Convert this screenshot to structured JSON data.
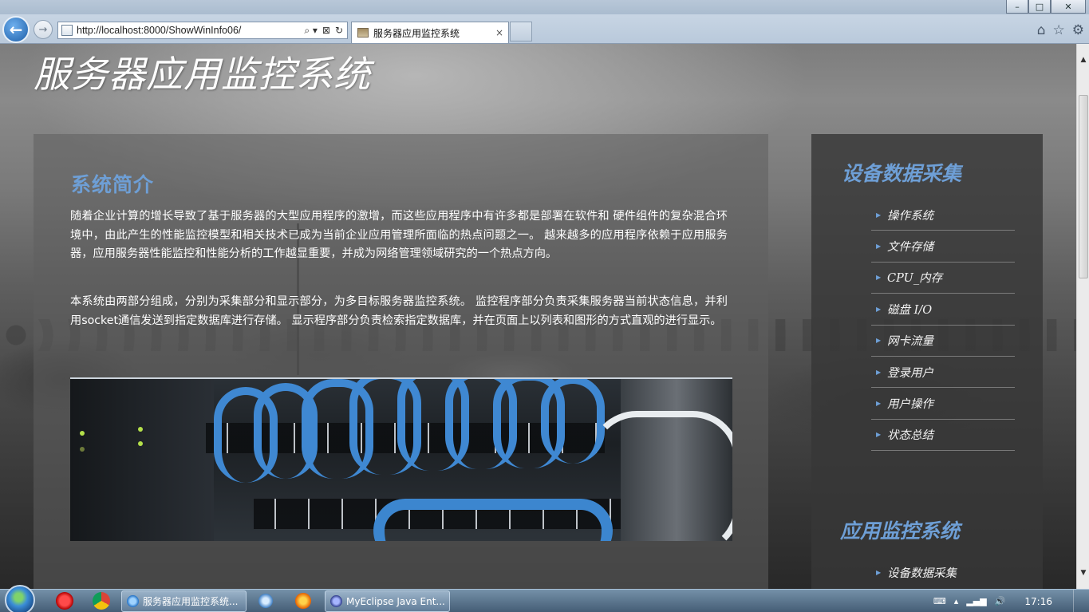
{
  "browser": {
    "url": "http://localhost:8000/ShowWinInfo06/",
    "tab_title": "服务器应用监控系统",
    "tab_close": "×",
    "back_glyph": "←",
    "forward_glyph": "→",
    "addr_tools": [
      "⌕ ▾",
      "⊠",
      "↻"
    ],
    "right_icons": [
      "⌂",
      "☆",
      "⚙"
    ],
    "window_buttons": {
      "minimize": "–",
      "maximize": "□",
      "close": "✕"
    }
  },
  "page": {
    "site_title": "服务器应用监控系统",
    "intro": {
      "heading": "系统简介",
      "paragraphs": [
        "随着企业计算的增长导致了基于服务器的大型应用程序的激增，而这些应用程序中有许多都是部署在软件和 硬件组件的复杂混合环境中，由此产生的性能监控模型和相关技术已成为当前企业应用管理所面临的热点问题之一。 越来越多的应用程序依赖于应用服务器，应用服务器性能监控和性能分析的工作越显重要，并成为网络管理领域研究的一个热点方向。",
        "本系统由两部分组成，分别为采集部分和显示部分，为多目标服务器监控系统。 监控程序部分负责采集服务器当前状态信息，并利用socket通信发送到指定数据库进行存储。 显示程序部分负责检索指定数据库，并在页面上以列表和图形的方式直观的进行显示。"
      ]
    },
    "sidebar": {
      "section1": {
        "heading": "设备数据采集",
        "items": [
          "操作系统",
          "文件存储",
          "CPU_内存",
          "磁盘 I/O",
          "网卡流量",
          "登录用户",
          "用户操作",
          "状态总结"
        ]
      },
      "section2": {
        "heading": "应用监控系统",
        "items": [
          "设备数据采集"
        ]
      },
      "bullet": "▶"
    }
  },
  "scrollbar": {
    "up": "▲",
    "down": "▼"
  },
  "taskbar": {
    "tasks": [
      "服务器应用监控系统...",
      "MyEclipse Java Ent..."
    ],
    "clock": "17:16",
    "tray_icons": [
      "⌨",
      "▴",
      "▂▄▆",
      "🔊"
    ]
  },
  "colors": {
    "accent_blue": "#6e9fd6",
    "panel_bg": "#5f5f5f",
    "sidebar_bg": "#373737"
  }
}
